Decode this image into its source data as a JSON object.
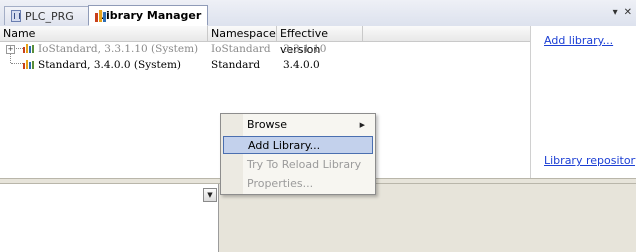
{
  "tabs": [
    {
      "label": "PLC_PRG",
      "active": false
    },
    {
      "label": "Library Manager",
      "active": true
    }
  ],
  "window_controls": {
    "pin": "▾",
    "close": "✕"
  },
  "table": {
    "columns": [
      "Name",
      "Namespace",
      "Effective version"
    ],
    "rows": [
      {
        "name": "IoStandard, 3.3.1.10 (System)",
        "namespace": "IoStandard",
        "version": "3.3.1.10",
        "greyed": true,
        "expandable": true
      },
      {
        "name": "Standard, 3.4.0.0 (System)",
        "namespace": "Standard",
        "version": "3.4.0.0",
        "greyed": false,
        "expandable": false
      }
    ]
  },
  "links": {
    "add_library": "Add library...",
    "library_repository": "Library repository..."
  },
  "context_menu": {
    "items": [
      {
        "label": "Browse",
        "state": "normal",
        "submenu": true
      },
      {
        "label": "Add Library...",
        "state": "highlighted",
        "submenu": false
      },
      {
        "label": "Try To Reload Library",
        "state": "disabled",
        "submenu": false
      },
      {
        "label": "Properties...",
        "state": "disabled",
        "submenu": false
      }
    ]
  },
  "colors": {
    "link": "#1c3fd4",
    "highlight": "#c3d1ec",
    "disabled_text": "#9b9b9b",
    "lib_icon": [
      "#c9401b",
      "#e6a21a",
      "#2e6db3"
    ]
  },
  "icons": {
    "prg_tab": "program-document-icon",
    "lib_tab": "library-books-icon",
    "row_lib": "library-books-icon",
    "submenu": "chevron-right-icon",
    "dropdown": "chevron-down-icon"
  }
}
